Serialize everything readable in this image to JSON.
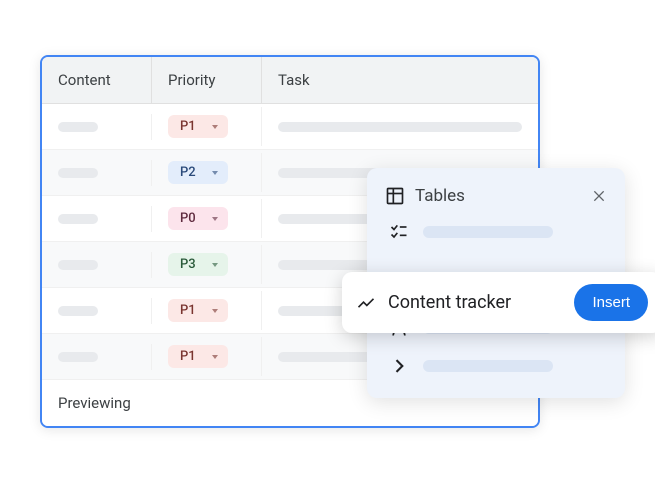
{
  "table": {
    "headers": {
      "content": "Content",
      "priority": "Priority",
      "task": "Task"
    },
    "rows": [
      {
        "priority": "P1",
        "chipClass": "chip-p1",
        "taskWidth": "long"
      },
      {
        "priority": "P2",
        "chipClass": "chip-p2",
        "taskWidth": "med"
      },
      {
        "priority": "P0",
        "chipClass": "chip-p0",
        "taskWidth": "long"
      },
      {
        "priority": "P3",
        "chipClass": "chip-p3",
        "taskWidth": "med"
      },
      {
        "priority": "P1",
        "chipClass": "chip-p1",
        "taskWidth": "long"
      },
      {
        "priority": "P1",
        "chipClass": "chip-p1",
        "taskWidth": "med"
      }
    ],
    "footer": "Previewing"
  },
  "panel": {
    "title": "Tables",
    "highlight": {
      "label": "Content tracker",
      "button": "Insert"
    }
  }
}
